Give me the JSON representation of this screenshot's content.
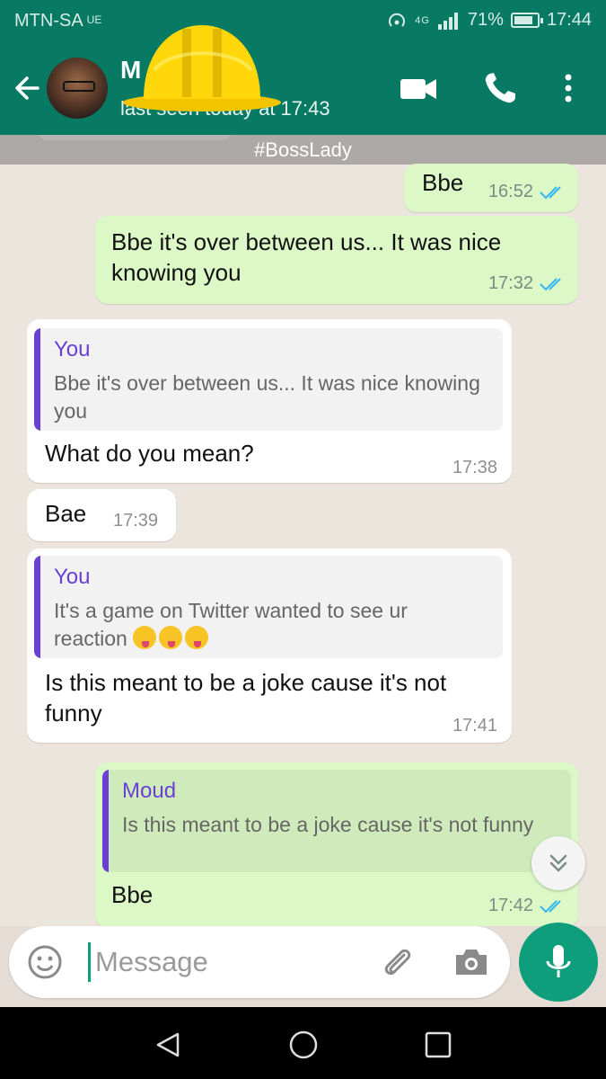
{
  "status_bar": {
    "carrier": "MTN-SA",
    "carrier_sub": "UE",
    "network": "4G",
    "battery": "71%",
    "battery_level": 0.71,
    "time": "17:44"
  },
  "header": {
    "contact_name": "M",
    "last_seen": "last seen today at 17:43"
  },
  "chat": {
    "date_chip": "#BossLady",
    "messages": [
      {
        "direction": "out",
        "text": "Bbe",
        "time": "16:52"
      },
      {
        "direction": "out",
        "text": "Bbe it's over between us... It was nice knowing you",
        "time": "17:32"
      },
      {
        "direction": "in",
        "quote_author": "You",
        "quote_text": "Bbe it's over between us... It was nice knowing you",
        "text": "What do you mean?",
        "time": "17:38"
      },
      {
        "direction": "in",
        "text": "Bae",
        "time": "17:39"
      },
      {
        "direction": "in",
        "quote_author": "You",
        "quote_text": "It's a game on Twitter wanted to see ur reaction",
        "quote_emojis": "😜😜😜",
        "text": "Is this meant to be a joke cause it's not funny",
        "time": "17:41"
      },
      {
        "direction": "out",
        "quote_author": "Moud",
        "quote_text": "Is this meant to be a joke cause it's not funny",
        "text": "Bbe",
        "time": "17:42"
      }
    ]
  },
  "composer": {
    "placeholder": "Message"
  },
  "colors": {
    "header": "#087a63",
    "outgoing_bubble": "#dcf8c6",
    "incoming_bubble": "#ffffff",
    "quote_accent": "#6a40d4",
    "read_ticks": "#34b7f1",
    "mic_button": "#0e9e7c"
  }
}
